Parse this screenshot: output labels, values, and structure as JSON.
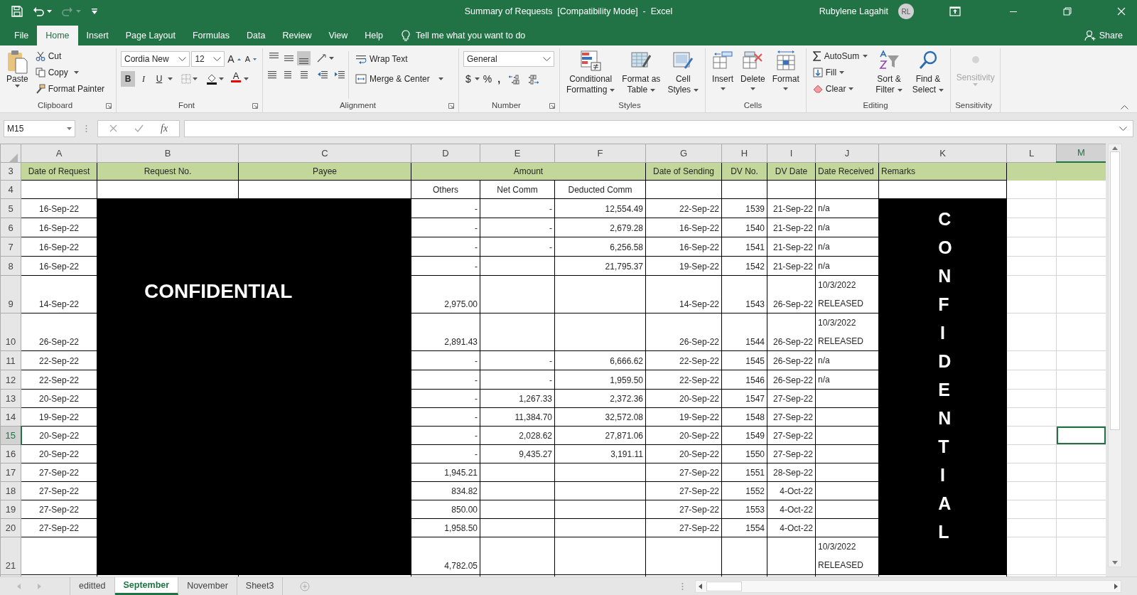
{
  "title_bar": {
    "title": "Summary of Requests  [Compatibility Mode]  -  Excel",
    "user": "Rubylene Lagahit",
    "avatar_initials": "RL"
  },
  "ribbon_tabs": [
    {
      "label": "File",
      "selected": false
    },
    {
      "label": "Home",
      "selected": true
    },
    {
      "label": "Insert",
      "selected": false
    },
    {
      "label": "Page Layout",
      "selected": false
    },
    {
      "label": "Formulas",
      "selected": false
    },
    {
      "label": "Data",
      "selected": false
    },
    {
      "label": "Review",
      "selected": false
    },
    {
      "label": "View",
      "selected": false
    },
    {
      "label": "Help",
      "selected": false
    }
  ],
  "tell_me": "Tell me what you want to do",
  "share": "Share",
  "ribbon": {
    "clipboard": {
      "label": "Clipboard",
      "paste": "Paste",
      "cut": "Cut",
      "copy": "Copy",
      "format_painter": "Format Painter"
    },
    "font": {
      "label": "Font",
      "font_name": "Cordia New",
      "font_size": "12",
      "grow": "A",
      "shrink": "A",
      "bold": {
        "label": "B",
        "on": true
      },
      "italic": {
        "label": "I",
        "on": false
      },
      "underline": {
        "label": "U",
        "on": false
      },
      "font_color": "A"
    },
    "alignment": {
      "label": "Alignment",
      "top_align": false,
      "middle_align": false,
      "bottom_align": true,
      "wrap_text": "Wrap Text",
      "merge": "Merge & Center"
    },
    "number": {
      "label": "Number",
      "format": "General",
      "currency": "$",
      "percent": "%",
      "comma": ","
    },
    "styles": {
      "label": "Styles",
      "buttons": [
        {
          "top": "Conditional",
          "bottom": "Formatting"
        },
        {
          "top": "Format as",
          "bottom": "Table"
        },
        {
          "top": "Cell",
          "bottom": "Styles"
        }
      ]
    },
    "cells": {
      "label": "Cells",
      "buttons": [
        "Insert",
        "Delete",
        "Format"
      ]
    },
    "editing": {
      "label": "Editing",
      "autosum": "AutoSum",
      "fill": "Fill",
      "clear": "Clear",
      "sort": {
        "top": "Sort &",
        "bottom": "Filter"
      },
      "find": {
        "top": "Find &",
        "bottom": "Select"
      }
    },
    "sensitivity": {
      "label": "Sensitivity",
      "button": "Sensitivity",
      "disabled": true
    }
  },
  "formula_bar": {
    "name_box": "M15",
    "function_symbol": "fx"
  },
  "columns": [
    {
      "label": "A",
      "selected": false
    },
    {
      "label": "B",
      "selected": false
    },
    {
      "label": "C",
      "selected": false
    },
    {
      "label": "D",
      "selected": false
    },
    {
      "label": "E",
      "selected": false
    },
    {
      "label": "F",
      "selected": false
    },
    {
      "label": "G",
      "selected": false
    },
    {
      "label": "H",
      "selected": false
    },
    {
      "label": "I",
      "selected": false
    },
    {
      "label": "J",
      "selected": false
    },
    {
      "label": "K",
      "selected": false
    },
    {
      "label": "L",
      "selected": false
    },
    {
      "label": "M",
      "selected": true
    }
  ],
  "headers": {
    "row": "3",
    "date_of_request": "Date of Request",
    "request_no": "Request No.",
    "payee": "Payee",
    "amount": "Amount",
    "date_of_sending": "Date of Sending",
    "dv_no": "DV No.",
    "dv_date": "DV Date",
    "date_received": "Date Received",
    "remarks": "Remarks"
  },
  "subheaders": {
    "row": "4",
    "others": "Others",
    "net_comm": "Net Comm",
    "deducted_comm": "Deducted Comm"
  },
  "confidential_mask": {
    "text": "CONFIDENTIAL"
  },
  "remarks_mask": {
    "text": "CONFIDENTIAL"
  },
  "rows": [
    {
      "row": "5",
      "selected": false,
      "date_of_request": "16-Sep-22",
      "others": "-",
      "net_comm": "-",
      "deducted_comm": "12,554.49",
      "date_of_sending": "22-Sep-22",
      "dv_no": "1539",
      "dv_date": "21-Sep-22",
      "date_received": "n/a"
    },
    {
      "row": "6",
      "selected": false,
      "date_of_request": "16-Sep-22",
      "others": "-",
      "net_comm": "-",
      "deducted_comm": "2,679.28",
      "date_of_sending": "16-Sep-22",
      "dv_no": "1540",
      "dv_date": "21-Sep-22",
      "date_received": "n/a"
    },
    {
      "row": "7",
      "selected": false,
      "date_of_request": "16-Sep-22",
      "others": "-",
      "net_comm": "-",
      "deducted_comm": "6,256.58",
      "date_of_sending": "16-Sep-22",
      "dv_no": "1541",
      "dv_date": "21-Sep-22",
      "date_received": "n/a"
    },
    {
      "row": "8",
      "selected": false,
      "date_of_request": "16-Sep-22",
      "others": "-",
      "deducted_comm": "21,795.37",
      "date_of_sending": "19-Sep-22",
      "dv_no": "1542",
      "dv_date": "21-Sep-22",
      "date_received": "n/a"
    },
    {
      "row": "9",
      "selected": false,
      "date_of_request": "14-Sep-22",
      "others": "2,975.00",
      "date_of_sending": "14-Sep-22",
      "dv_no": "1543",
      "dv_date": "26-Sep-22",
      "date_received": "10/3/2022\nRELEASED"
    },
    {
      "row": "10",
      "selected": false,
      "date_of_request": "26-Sep-22",
      "others": "2,891.43",
      "date_of_sending": "26-Sep-22",
      "dv_no": "1544",
      "dv_date": "26-Sep-22",
      "date_received": "10/3/2022\nRELEASED"
    },
    {
      "row": "11",
      "selected": false,
      "date_of_request": "22-Sep-22",
      "others": "-",
      "net_comm": "-",
      "deducted_comm": "6,666.62",
      "date_of_sending": "22-Sep-22",
      "dv_no": "1545",
      "dv_date": "26-Sep-22",
      "date_received": "n/a"
    },
    {
      "row": "12",
      "selected": false,
      "date_of_request": "22-Sep-22",
      "others": "-",
      "net_comm": "-",
      "deducted_comm": "1,959.50",
      "date_of_sending": "22-Sep-22",
      "dv_no": "1546",
      "dv_date": "26-Sep-22",
      "date_received": "n/a"
    },
    {
      "row": "13",
      "selected": false,
      "date_of_request": "20-Sep-22",
      "others": "-",
      "net_comm": "1,267.33",
      "deducted_comm": "2,372.36",
      "date_of_sending": "20-Sep-22",
      "dv_no": "1547",
      "dv_date": "27-Sep-22"
    },
    {
      "row": "14",
      "selected": false,
      "date_of_request": "19-Sep-22",
      "others": "-",
      "net_comm": "11,384.70",
      "deducted_comm": "32,572.08",
      "date_of_sending": "19-Sep-22",
      "dv_no": "1548",
      "dv_date": "27-Sep-22"
    },
    {
      "row": "15",
      "selected": true,
      "date_of_request": "20-Sep-22",
      "others": "-",
      "net_comm": "2,028.62",
      "deducted_comm": "27,871.06",
      "date_of_sending": "20-Sep-22",
      "dv_no": "1549",
      "dv_date": "27-Sep-22"
    },
    {
      "row": "16",
      "selected": false,
      "date_of_request": "20-Sep-22",
      "others": "-",
      "net_comm": "9,435.27",
      "deducted_comm": "3,191.11",
      "date_of_sending": "20-Sep-22",
      "dv_no": "1550",
      "dv_date": "27-Sep-22"
    },
    {
      "row": "17",
      "selected": false,
      "date_of_request": "27-Sep-22",
      "others": "1,945.21",
      "date_of_sending": "27-Sep-22",
      "dv_no": "1551",
      "dv_date": "28-Sep-22"
    },
    {
      "row": "18",
      "selected": false,
      "date_of_request": "27-Sep-22",
      "others": "834.82",
      "date_of_sending": "27-Sep-22",
      "dv_no": "1552",
      "dv_date": "4-Oct-22"
    },
    {
      "row": "19",
      "selected": false,
      "date_of_request": "27-Sep-22",
      "others": "850.00",
      "date_of_sending": "27-Sep-22",
      "dv_no": "1553",
      "dv_date": "4-Oct-22"
    },
    {
      "row": "20",
      "selected": false,
      "date_of_request": "27-Sep-22",
      "others": "1,958.50",
      "date_of_sending": "27-Sep-22",
      "dv_no": "1554",
      "dv_date": "4-Oct-22"
    },
    {
      "row": "21",
      "selected": false,
      "others": "4,782.05",
      "date_received": "10/3/2022\nRELEASED"
    }
  ],
  "sheet_tabs": [
    {
      "label": "editted",
      "selected": false
    },
    {
      "label": "September",
      "selected": true
    },
    {
      "label": "November",
      "selected": false
    },
    {
      "label": "Sheet3",
      "selected": false
    }
  ]
}
